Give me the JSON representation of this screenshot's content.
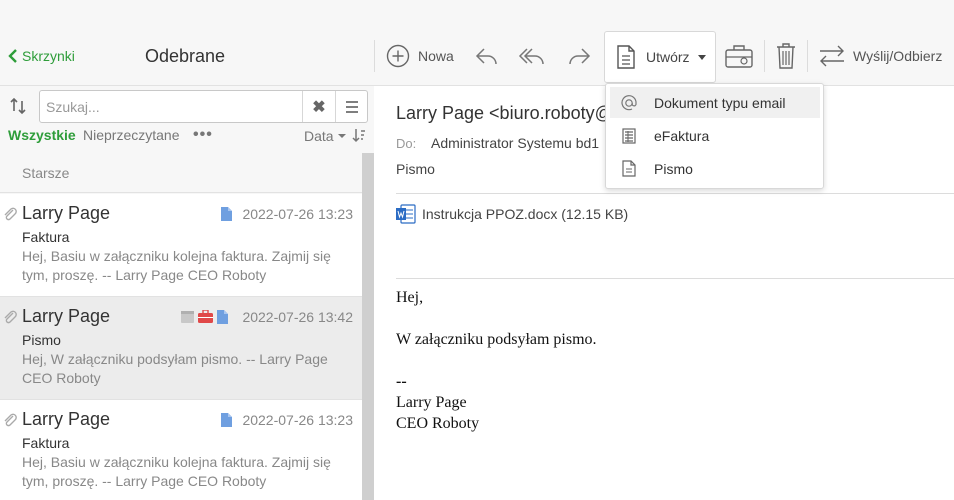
{
  "header": {
    "back_label": "Skrzynki",
    "folder_title": "Odebrane"
  },
  "toolbar": {
    "new_label": "Nowa",
    "create_label": "Utwórz",
    "send_receive_label": "Wyślij/Odbierz"
  },
  "create_menu": {
    "items": [
      {
        "label": "Dokument typu email",
        "icon": "at-icon"
      },
      {
        "label": "eFaktura",
        "icon": "invoice-icon"
      },
      {
        "label": "Pismo",
        "icon": "document-icon"
      }
    ]
  },
  "search": {
    "placeholder": "Szukaj...",
    "clear_label": "✖"
  },
  "filters": {
    "all_label": "Wszystkie",
    "unread_label": "Nieprzeczytane",
    "more_label": "•••",
    "sort_label": "Data"
  },
  "list": {
    "group_label": "Starsze",
    "items": [
      {
        "sender": "Larry Page",
        "date": "2022-07-26 13:23",
        "subject": "Faktura",
        "preview": "Hej, Basiu w załączniku kolejna faktura. Zajmij się tym, proszę. -- Larry Page CEO Roboty"
      },
      {
        "sender": "Larry Page",
        "date": "2022-07-26 13:42",
        "subject": "Pismo",
        "preview": "Hej, W załączniku podsyłam pismo. -- Larry Page CEO Roboty"
      },
      {
        "sender": "Larry Page",
        "date": "2022-07-26 13:23",
        "subject": "Faktura",
        "preview": "Hej, Basiu w załączniku kolejna faktura. Zajmij się tym, proszę. -- Larry Page CEO Roboty"
      }
    ]
  },
  "message": {
    "from": "Larry Page <biuro.roboty@",
    "to_label": "Do:",
    "to": "Administrator Systemu bd1",
    "type": "Pismo",
    "attachment": "Instrukcja PPOZ.docx (12.15 KB)",
    "body": {
      "line1": "Hej,",
      "line2": "W załączniku podsyłam pismo.",
      "line3": "--",
      "line4": "Larry Page",
      "line5": "CEO Roboty"
    }
  },
  "colors": {
    "accent": "#2e9d3a",
    "icon_blue": "#6f9fe0",
    "icon_red": "#e04848",
    "icon_gray": "#b5b5b5"
  }
}
